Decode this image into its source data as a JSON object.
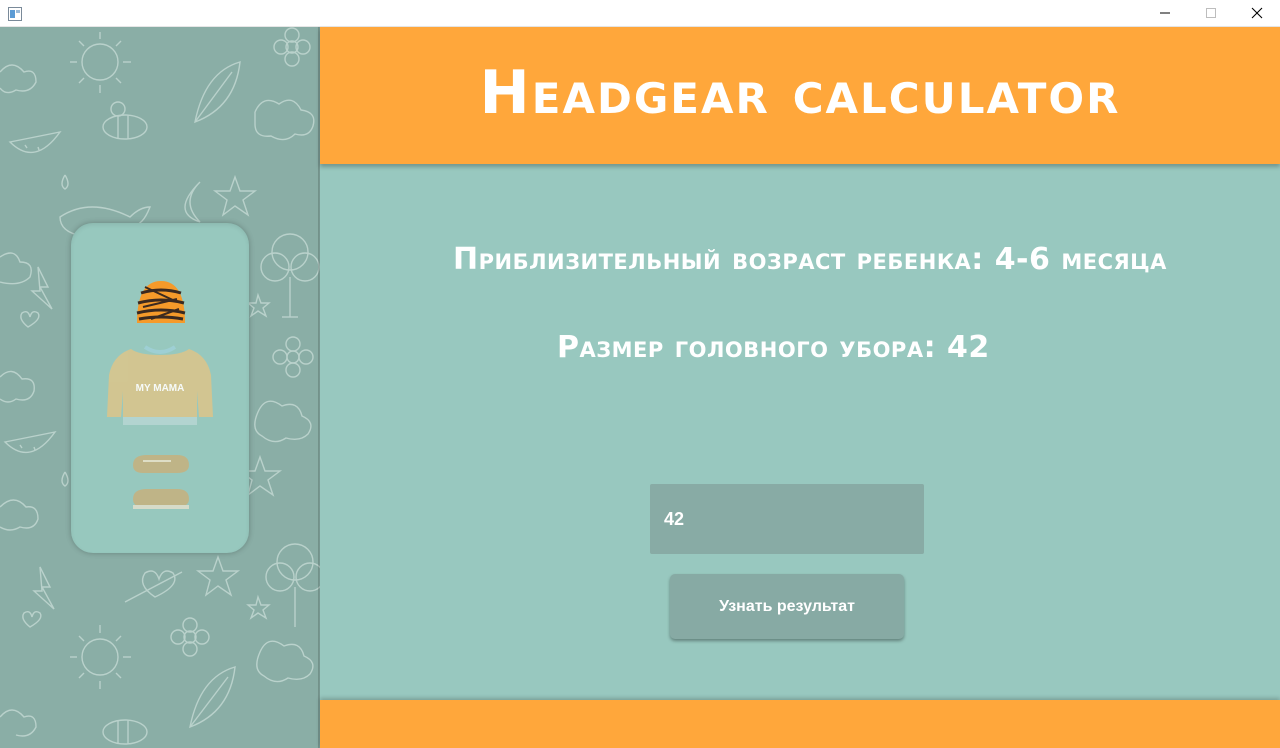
{
  "window": {
    "icon": "app-window-icon",
    "controls": [
      "minimize-icon",
      "maximize-icon",
      "close-icon"
    ]
  },
  "header": {
    "title": "Headgear calculator"
  },
  "results": {
    "age_text": "Приблизительный возраст ребенка: 4-6 месяца",
    "size_text": "Размер головного убора: 42"
  },
  "form": {
    "input_value": "42",
    "button_label": "Узнать результат"
  },
  "sidebar": {
    "illustration": "baby-outfit-illustration",
    "illustration_text": "MY MAMA"
  },
  "colors": {
    "accent_orange": "#ffa73b",
    "content_teal": "#98c8bf",
    "sidebar_teal": "#8aaea6",
    "input_bg": "#88aba5"
  }
}
